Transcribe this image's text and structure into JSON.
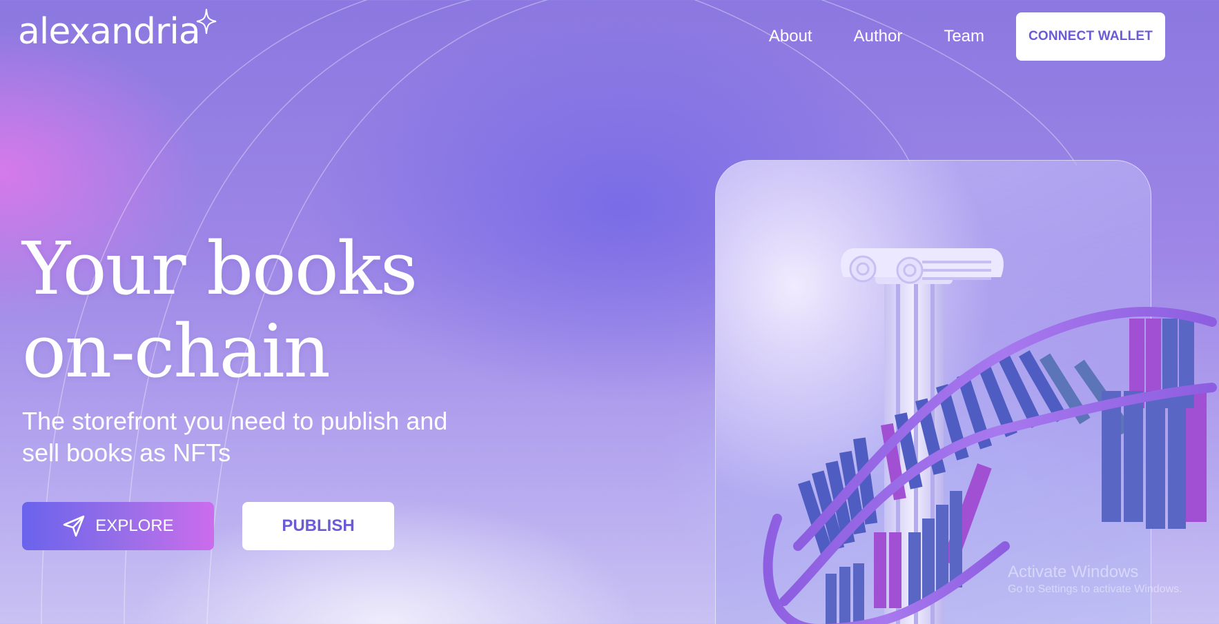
{
  "logo": {
    "text": "alexandria"
  },
  "nav": {
    "links": [
      "About",
      "Author",
      "Team"
    ],
    "connect_wallet": "CONNECT WALLET"
  },
  "hero": {
    "title_line1": "Your books",
    "title_line2": "on-chain",
    "subtitle": "The storefront you need to publish and sell books as NFTs",
    "explore_label": "EXPLORE",
    "publish_label": "PUBLISH"
  },
  "watermark": {
    "line1": "Activate Windows",
    "line2": "Go to Settings to activate Windows."
  },
  "colors": {
    "accent": "#6a5bd6",
    "gradient_start": "#6b63ec",
    "gradient_end": "#cc6cec"
  },
  "icons": [
    "sparkle-icon",
    "send-icon"
  ]
}
